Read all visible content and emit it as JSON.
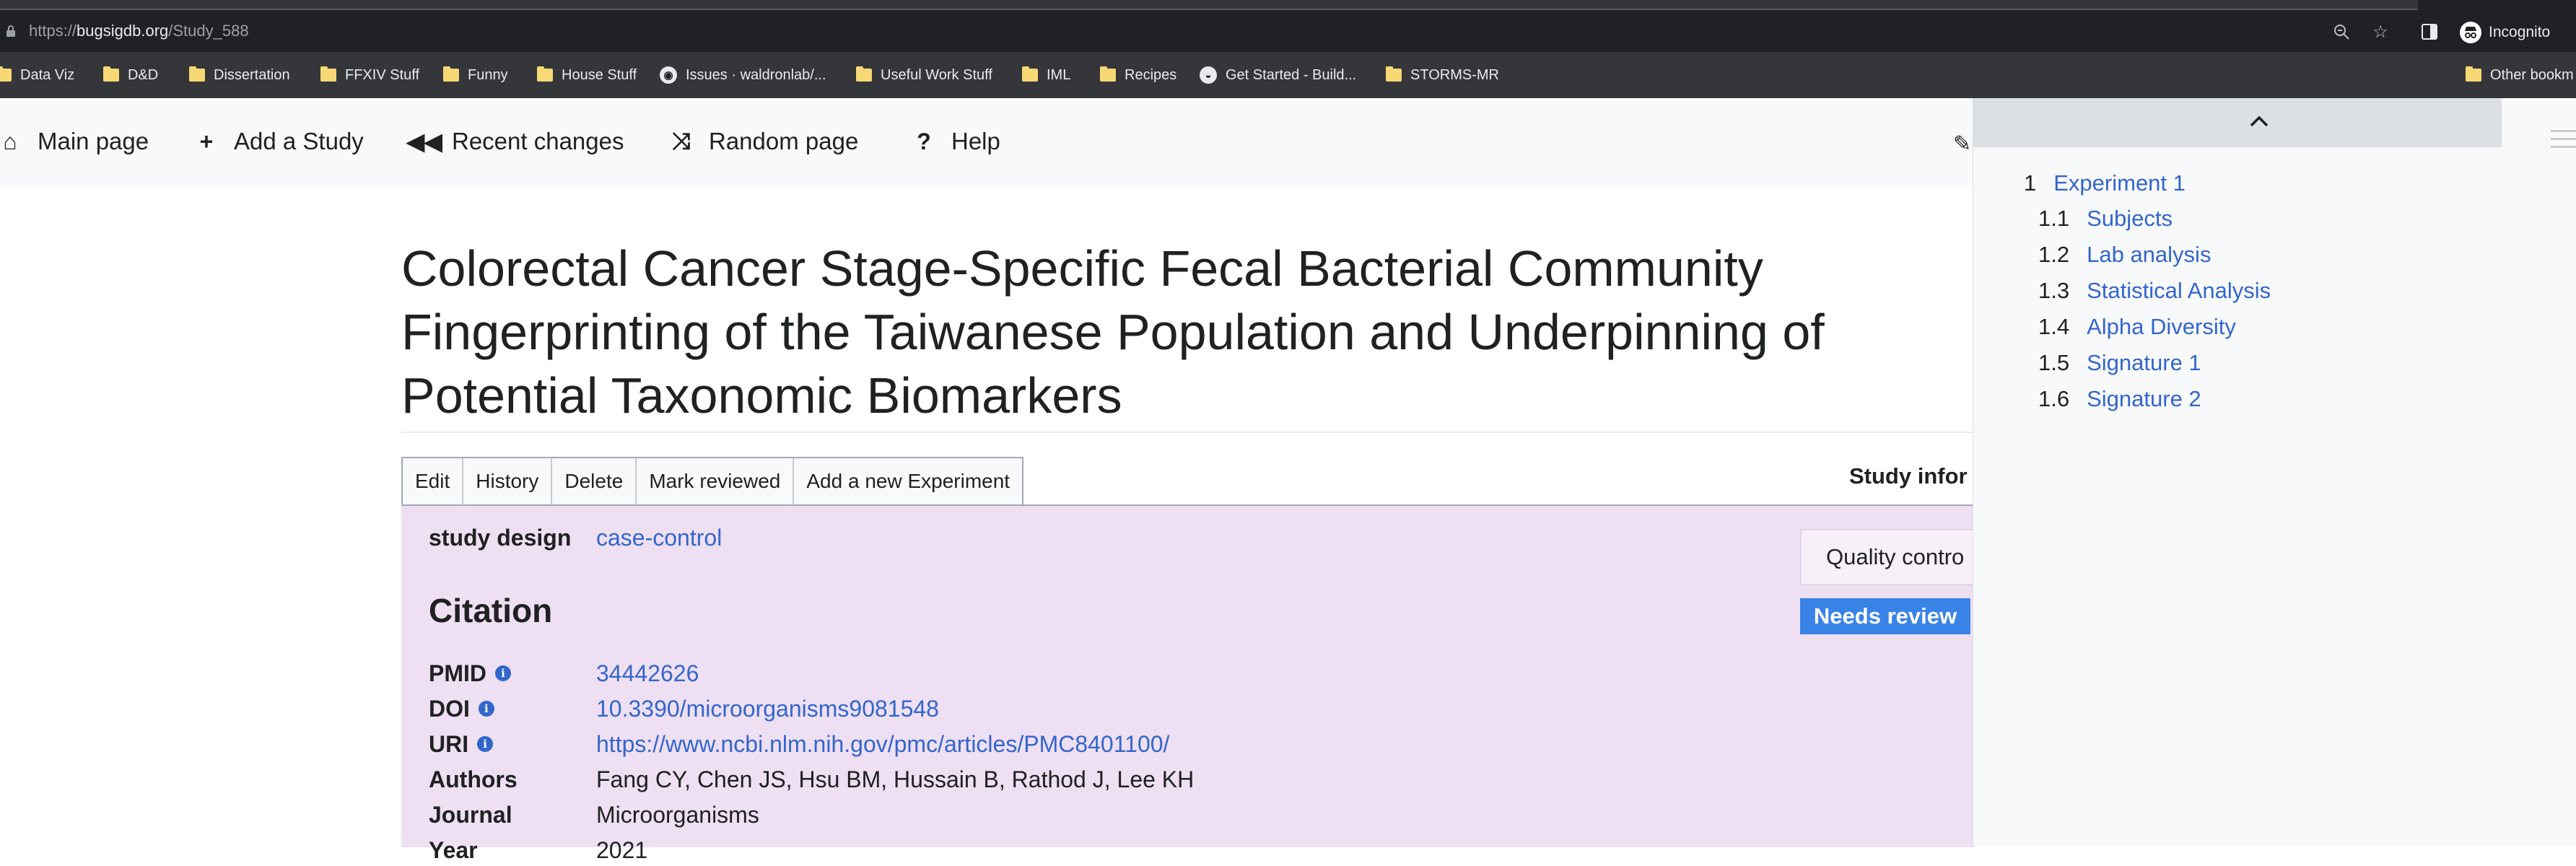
{
  "browser": {
    "url_prefix": "https://",
    "url_host": "bugsigdb.org",
    "url_path": "/Study_588",
    "incognito_label": "Incognito"
  },
  "bookmarks": [
    {
      "label": "Data Viz",
      "icon": "folder-icon"
    },
    {
      "label": "D&D",
      "icon": "folder-icon"
    },
    {
      "label": "Dissertation",
      "icon": "folder-icon"
    },
    {
      "label": "FFXIV Stuff",
      "icon": "folder-icon"
    },
    {
      "label": "Funny",
      "icon": "folder-icon"
    },
    {
      "label": "House Stuff",
      "icon": "folder-icon"
    },
    {
      "label": "Issues · waldronlab/...",
      "icon": "github-icon"
    },
    {
      "label": "Useful Work Stuff",
      "icon": "folder-icon"
    },
    {
      "label": "IML",
      "icon": "folder-icon"
    },
    {
      "label": "Recipes",
      "icon": "folder-icon"
    },
    {
      "label": "Get Started - Build...",
      "icon": "site-icon"
    },
    {
      "label": "STORMS-MR",
      "icon": "folder-icon"
    }
  ],
  "other_bookmarks_label": "Other bookm",
  "nav": {
    "main_page": "Main page",
    "add_study": "Add a Study",
    "recent_changes": "Recent changes",
    "random_page": "Random page",
    "help": "Help"
  },
  "page_title": "Colorectal Cancer Stage-Specific Fecal Bacterial Community Fingerprinting of the Taiwanese Population and Underpinning of Potential Taxonomic Biomarkers",
  "tabs": [
    "Edit",
    "History",
    "Delete",
    "Mark reviewed",
    "Add a new Experiment"
  ],
  "study_info_heading": "Study infor",
  "study_design": {
    "label": "study design",
    "value": "case-control"
  },
  "citation_heading": "Citation",
  "citation": {
    "pmid": {
      "label": "PMID",
      "value": "34442626"
    },
    "doi": {
      "label": "DOI",
      "value": "10.3390/microorganisms9081548"
    },
    "uri": {
      "label": "URI",
      "value": "https://www.ncbi.nlm.nih.gov/pmc/articles/PMC8401100/"
    },
    "authors": {
      "label": "Authors",
      "value": "Fang CY, Chen JS, Hsu BM, Hussain B, Rathod J, Lee KH"
    },
    "journal": {
      "label": "Journal",
      "value": "Microorganisms"
    },
    "year": {
      "label": "Year",
      "value": "2021"
    }
  },
  "quality_control": {
    "label": "Quality contro",
    "status": "Needs review"
  },
  "toc": [
    {
      "num": "1",
      "label": "Experiment 1"
    },
    {
      "num": "1.1",
      "label": "Subjects"
    },
    {
      "num": "1.2",
      "label": "Lab analysis"
    },
    {
      "num": "1.3",
      "label": "Statistical Analysis"
    },
    {
      "num": "1.4",
      "label": "Alpha Diversity"
    },
    {
      "num": "1.5",
      "label": "Signature 1"
    },
    {
      "num": "1.6",
      "label": "Signature 2"
    }
  ],
  "colors": {
    "link": "#3366cc",
    "needs_review": "#3a83e6",
    "content_bg": "#eedff2"
  }
}
